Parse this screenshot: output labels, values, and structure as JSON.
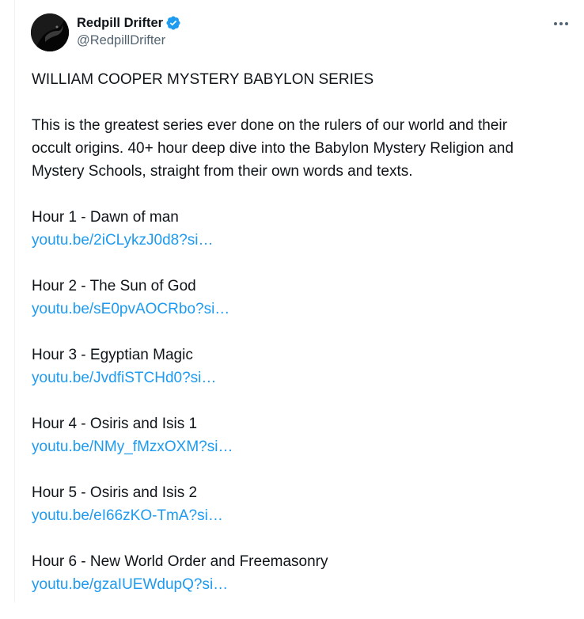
{
  "author": {
    "display_name": "Redpill Drifter",
    "handle": "@RedpillDrifter",
    "verified": true
  },
  "colors": {
    "link": "#1d9bf0",
    "text": "#0f1419",
    "secondary": "#536471",
    "verified_badge": "#1d9bf0"
  },
  "icons": {
    "verified": "verified-badge-icon",
    "more": "more-options-icon"
  },
  "tweet": {
    "title": "WILLIAM COOPER MYSTERY BABYLON SERIES",
    "intro_lines": [
      "This is the greatest series ever done on the rulers of our world and their",
      "occult origins. 40+ hour deep dive into the Babylon Mystery Religion and",
      "Mystery Schools, straight from their own words and texts."
    ],
    "entries": [
      {
        "title": "Hour 1 - Dawn of man",
        "link": "youtu.be/2iCLykzJ0d8?si…"
      },
      {
        "title": "Hour 2 - The Sun of God",
        "link": "youtu.be/sE0pvAOCRbo?si…"
      },
      {
        "title": "Hour 3 - Egyptian Magic",
        "link": "youtu.be/JvdfiSTCHd0?si…"
      },
      {
        "title": "Hour 4 - Osiris and Isis 1",
        "link": "youtu.be/NMy_fMzxOXM?si…"
      },
      {
        "title": "Hour 5 - Osiris and Isis 2",
        "link": "youtu.be/eI66zKO-TmA?si…"
      },
      {
        "title": "Hour 6 - New World Order and Freemasonry",
        "link": "youtu.be/gzaIUEWdupQ?si…"
      }
    ]
  }
}
